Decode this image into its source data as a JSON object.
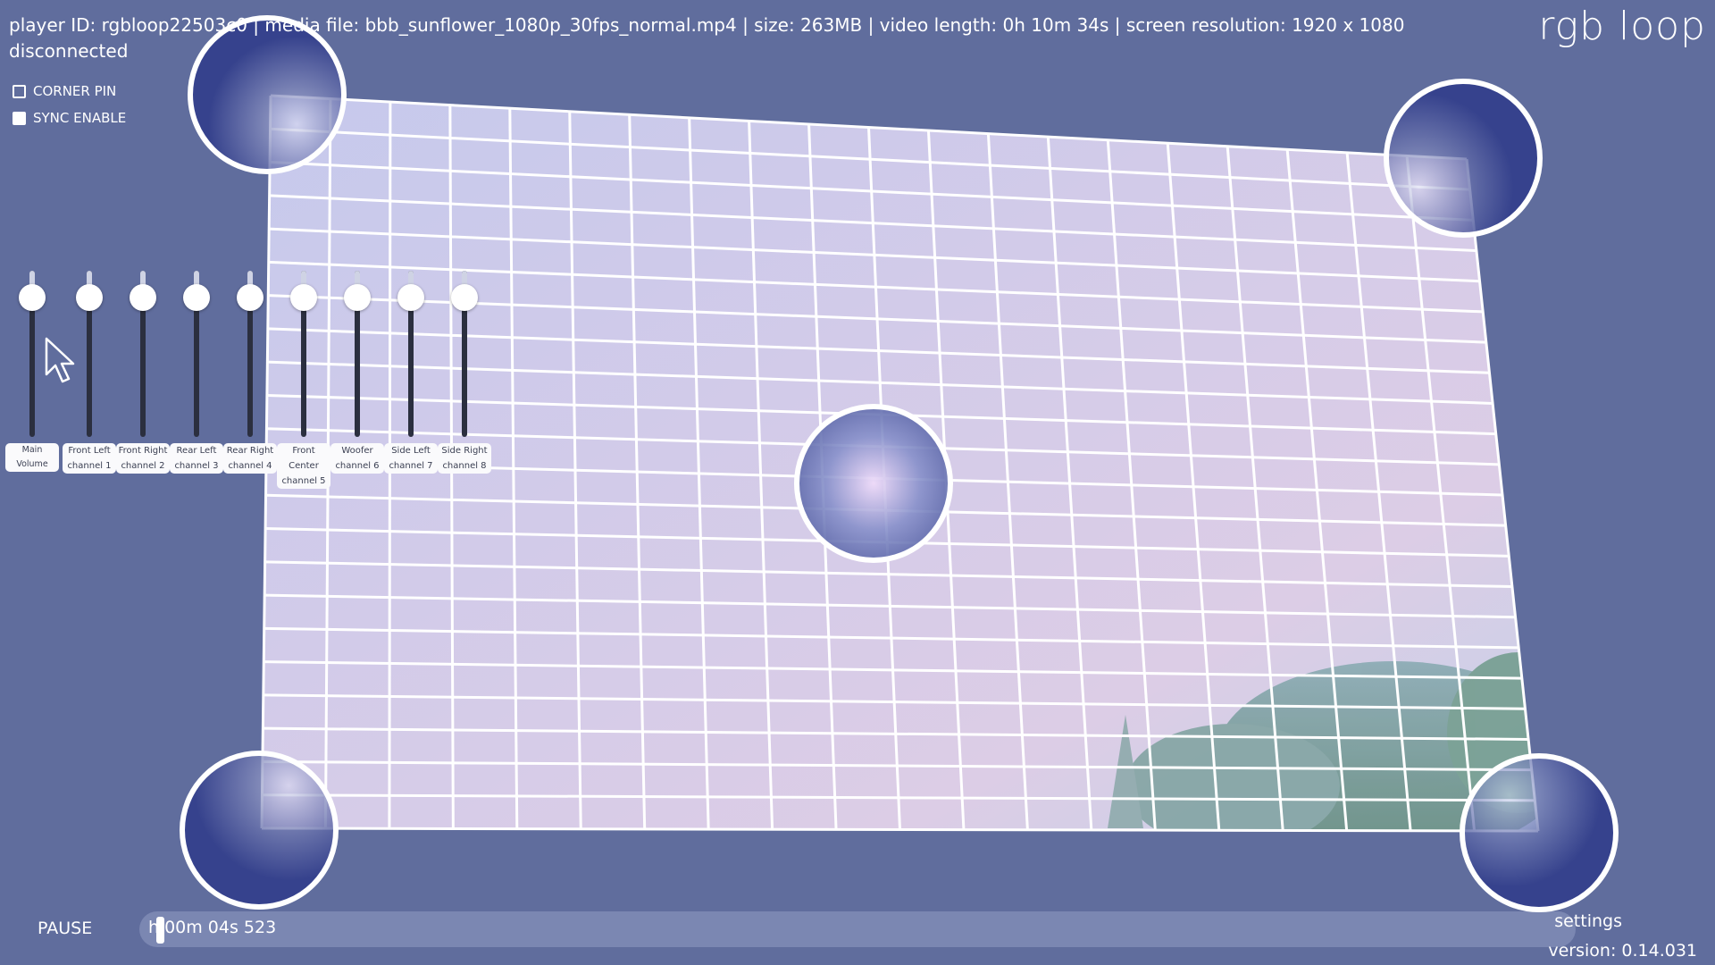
{
  "header": {
    "info_line": "player ID: rgbloop22503c0 | media file: bbb_sunflower_1080p_30fps_normal.mp4 | size: 263MB | video length: 0h 10m 34s  | screen resolution: 1920 x 1080",
    "status": "disconnected",
    "brand": "rgb loop"
  },
  "options": {
    "corner_pin_label": "CORNER PIN",
    "corner_pin_checked": false,
    "sync_enable_label": "SYNC ENABLE",
    "sync_enable_checked": true
  },
  "mixer": {
    "channels": [
      {
        "name": "Main Volume",
        "sub": "",
        "level": 0.84
      },
      {
        "name": "Front Left",
        "sub": "channel 1",
        "level": 0.84
      },
      {
        "name": "Front Right",
        "sub": "channel 2",
        "level": 0.84
      },
      {
        "name": "Rear Left",
        "sub": "channel 3",
        "level": 0.84
      },
      {
        "name": "Rear Right",
        "sub": "channel 4",
        "level": 0.84
      },
      {
        "name": "Front Center",
        "sub": "channel 5",
        "level": 0.84
      },
      {
        "name": "Woofer",
        "sub": "channel 6",
        "level": 0.84
      },
      {
        "name": "Side Left",
        "sub": "channel 7",
        "level": 0.84
      },
      {
        "name": "Side Right",
        "sub": "channel 8",
        "level": 0.84
      }
    ]
  },
  "playback": {
    "pause_label": "PAUSE",
    "timecode": "h 00m 04s 523",
    "progress": 0.007
  },
  "footer": {
    "settings_label": "settings",
    "version": "version: 0.14.031"
  },
  "colors": {
    "background": "#606d9d",
    "grid_line": "#ffffff"
  }
}
